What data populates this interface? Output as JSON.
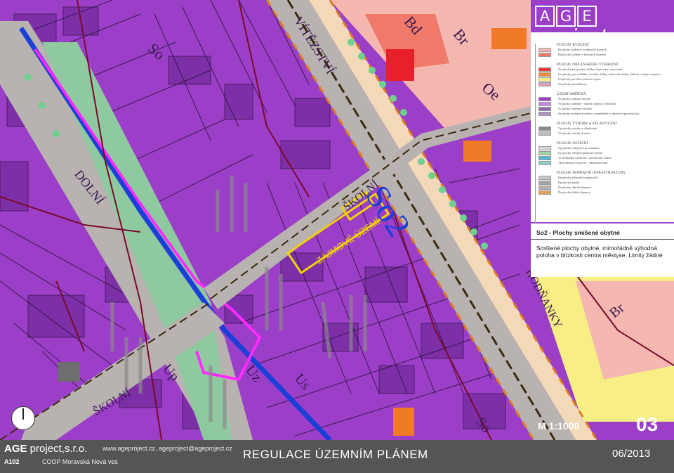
{
  "map": {
    "street_labels": [
      "VÍTĚZSTVÍ",
      "DOLNÍ",
      "ŠKOLNÍ",
      "ŠKOLNÍ",
      "HODŇANKY"
    ],
    "zone_labels": [
      "So",
      "Bd",
      "Br",
      "Oe",
      "Up",
      "Uz",
      "Us",
      "So",
      "Br"
    ],
    "focus_zone_label": "So2",
    "area_label": "ZÁJMOVÉ ÚZEMÍ",
    "colors": {
      "mixed_housing": "#9b3fc9",
      "mixed_housing_dark": "#7d2fa8",
      "road": "#b8b2b0",
      "green": "#8fc9a0",
      "water": "#1b3fd9",
      "focus_outline": "#f2d200",
      "civic": "#f07a2a"
    }
  },
  "header": {
    "logo_letters": [
      "A",
      "G",
      "E"
    ],
    "logo_word": "project"
  },
  "legend": {
    "groups": [
      {
        "heading": "PLOCHY BYDLENÍ",
        "items": [
          {
            "label": "Br plochy bydlení v rodinných domech",
            "color": "#f5b8b0"
          },
          {
            "label": "Bd plochy bydlení v bytových domech",
            "color": "#f07a6a"
          }
        ]
      },
      {
        "heading": "PLOCHY OBČANSKÉHO VYBAVENÍ",
        "items": [
          {
            "label": "Ov plochy pro prodej, služby, ubytování, stravování",
            "color": "#e83a3a"
          },
          {
            "label": "Ou plochy pro vzdělání, sociální služby, zdravotní služby, kultura, veřejnou správu",
            "color": "#f08c3a"
          },
          {
            "label": "Os plochy pro tělovýchovu a sport",
            "color": "#f7ef86"
          },
          {
            "label": "Oe plochy pro hřbitovy",
            "color": "#d9a0c0"
          }
        ]
      },
      {
        "heading": "ÚZEMÍ SMÍŠENÁ",
        "items": [
          {
            "label": "So plochy smíšené obytné",
            "color": "#9b3fc9"
          },
          {
            "label": "Sv plochy smíšené - vnitřní obytný a rekreační",
            "color": "#c489e0"
          },
          {
            "label": "Sv plochy smíšené výrobní",
            "color": "#8f6bb0"
          },
          {
            "label": "Sa plochy smíšené (výrobní, zemědělské a obytné) (agroturistika)",
            "color": "#b493c8"
          }
        ]
      },
      {
        "heading": "PLOCHY VÝROBY A SKLADOVÁNÍ",
        "items": [
          {
            "label": "Vp plochy výroby a skladování",
            "color": "#8c8c8c"
          },
          {
            "label": "Vd plochy výroby drobné",
            "color": "#bdbdbd"
          }
        ]
      },
      {
        "heading": "PLOCHY OSTATNÍ",
        "items": [
          {
            "label": "Up plochy veřejných prostranství",
            "color": "#d8d8d8"
          },
          {
            "label": "Uz plochy veřejné (parkové) zeleně",
            "color": "#9fd6a8"
          },
          {
            "label": "Tv technické vybavení - zásobování vodou",
            "color": "#5ab4d6"
          },
          {
            "label": "Tk technické vybavení - odkanalizování",
            "color": "#8fd0c8"
          }
        ]
      },
      {
        "heading": "PLOCHY DOPRAVNÍ INFRASTRUKTURY",
        "items": [
          {
            "label": "Dp plochy zařízených parkovišť",
            "color": "#c8c8c8"
          },
          {
            "label": "Dg plochy garáží",
            "color": "#a6a6a6"
          },
          {
            "label": "Ds plochy silniční dopravy",
            "color": "#b8b2b0"
          },
          {
            "label": "Dz plochy drážní dopravy",
            "color": "#e0a060"
          }
        ]
      }
    ]
  },
  "description": {
    "title": "So2 - Plochy smíšené obytné",
    "text": "Smíšené plochy obytné, mimořádně výhodná poloha v blízkosti centra městyse. Limity žádné"
  },
  "map_footer": {
    "scale": "M 1:1000",
    "sheet_number": "03"
  },
  "footer": {
    "brand_bold": "AGE",
    "brand_rest": " project,s.r.o.",
    "web": "www.ageproject.cz, ageproject@ageproject.cz",
    "code": "A102",
    "client": "COOP Moravská Nová ves",
    "title": "REGULACE ÚZEMNÍM PLÁNEM",
    "date": "06/2013"
  }
}
